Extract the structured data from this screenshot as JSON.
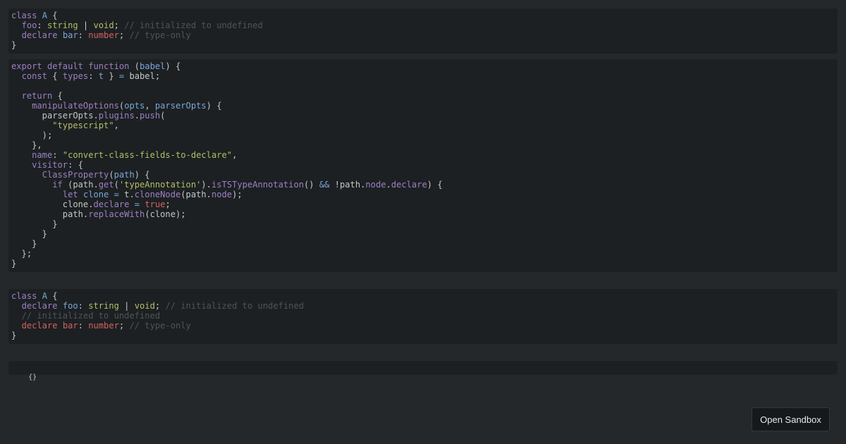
{
  "input_panel": {
    "lines": [
      [
        [
          "kw",
          "class "
        ],
        [
          "cls",
          "A"
        ],
        [
          "pn",
          " {"
        ]
      ],
      [
        [
          "pn",
          "  "
        ],
        [
          "prop",
          "foo"
        ],
        [
          "pn",
          ": "
        ],
        [
          "typ",
          "string"
        ],
        [
          "pn",
          " | "
        ],
        [
          "typ",
          "void"
        ],
        [
          "pn",
          "; "
        ],
        [
          "cm",
          "// initialized to undefined"
        ]
      ],
      [
        [
          "pn",
          "  "
        ],
        [
          "kw",
          "declare "
        ],
        [
          "cls",
          "bar"
        ],
        [
          "pn",
          ": "
        ],
        [
          "num",
          "number"
        ],
        [
          "pn",
          "; "
        ],
        [
          "cm",
          "// type-only"
        ]
      ],
      [
        [
          "pn",
          "}"
        ]
      ]
    ]
  },
  "plugin_panel": {
    "lines": [
      [
        [
          "kw",
          "export default function "
        ],
        [
          "pn",
          "("
        ],
        [
          "param",
          "babel"
        ],
        [
          "pn",
          ") {"
        ]
      ],
      [
        [
          "pn",
          "  "
        ],
        [
          "kw",
          "const "
        ],
        [
          "pn",
          "{ "
        ],
        [
          "prop",
          "types"
        ],
        [
          "pn",
          ": "
        ],
        [
          "param",
          "t"
        ],
        [
          "pn",
          " } "
        ],
        [
          "op",
          "="
        ],
        [
          "pn",
          " babel;"
        ]
      ],
      [
        [
          "pn",
          ""
        ]
      ],
      [
        [
          "pn",
          "  "
        ],
        [
          "kw",
          "return"
        ],
        [
          "pn",
          " {"
        ]
      ],
      [
        [
          "pn",
          "    "
        ],
        [
          "fn",
          "manipulateOptions"
        ],
        [
          "pn",
          "("
        ],
        [
          "param",
          "opts"
        ],
        [
          "pn",
          ", "
        ],
        [
          "param",
          "parserOpts"
        ],
        [
          "pn",
          ") {"
        ]
      ],
      [
        [
          "pn",
          "      parserOpts."
        ],
        [
          "fn",
          "plugins"
        ],
        [
          "pn",
          "."
        ],
        [
          "fn",
          "push"
        ],
        [
          "pn",
          "("
        ]
      ],
      [
        [
          "pn",
          "        "
        ],
        [
          "str",
          "\"typescript\""
        ],
        [
          "pn",
          ","
        ]
      ],
      [
        [
          "pn",
          "      );"
        ]
      ],
      [
        [
          "pn",
          "    },"
        ]
      ],
      [
        [
          "pn",
          "    "
        ],
        [
          "prop",
          "name"
        ],
        [
          "pn",
          ": "
        ],
        [
          "str",
          "\"convert-class-fields-to-declare\""
        ],
        [
          "pn",
          ","
        ]
      ],
      [
        [
          "pn",
          "    "
        ],
        [
          "prop",
          "visitor"
        ],
        [
          "pn",
          ": {"
        ]
      ],
      [
        [
          "pn",
          "      "
        ],
        [
          "fn",
          "ClassProperty"
        ],
        [
          "pn",
          "("
        ],
        [
          "param",
          "path"
        ],
        [
          "pn",
          ") {"
        ]
      ],
      [
        [
          "pn",
          "        "
        ],
        [
          "kw",
          "if"
        ],
        [
          "pn",
          " (path."
        ],
        [
          "fn",
          "get"
        ],
        [
          "pn",
          "("
        ],
        [
          "str",
          "'typeAnnotation'"
        ],
        [
          "pn",
          ")."
        ],
        [
          "fn",
          "isTSTypeAnnotation"
        ],
        [
          "pn",
          "() "
        ],
        [
          "op",
          "&&"
        ],
        [
          "pn",
          " !path."
        ],
        [
          "prop",
          "node"
        ],
        [
          "pn",
          "."
        ],
        [
          "prop",
          "declare"
        ],
        [
          "pn",
          ") {"
        ]
      ],
      [
        [
          "pn",
          "          "
        ],
        [
          "kw",
          "let "
        ],
        [
          "param",
          "clone "
        ],
        [
          "op",
          "="
        ],
        [
          "pn",
          " t."
        ],
        [
          "fn",
          "cloneNode"
        ],
        [
          "pn",
          "(path."
        ],
        [
          "prop",
          "node"
        ],
        [
          "pn",
          ");"
        ]
      ],
      [
        [
          "pn",
          "          clone."
        ],
        [
          "prop",
          "declare"
        ],
        [
          "pn",
          " "
        ],
        [
          "op",
          "="
        ],
        [
          "pn",
          " "
        ],
        [
          "bool",
          "true"
        ],
        [
          "pn",
          ";"
        ]
      ],
      [
        [
          "pn",
          "          path."
        ],
        [
          "fn",
          "replaceWith"
        ],
        [
          "pn",
          "(clone);"
        ]
      ],
      [
        [
          "pn",
          "        }"
        ]
      ],
      [
        [
          "pn",
          "      }"
        ]
      ],
      [
        [
          "pn",
          "    }"
        ]
      ],
      [
        [
          "pn",
          "  };"
        ]
      ],
      [
        [
          "pn",
          "}"
        ]
      ]
    ]
  },
  "output_panel": {
    "lines": [
      [
        [
          "kw",
          "class "
        ],
        [
          "cls",
          "A"
        ],
        [
          "pn",
          " {"
        ]
      ],
      [
        [
          "pn",
          "  "
        ],
        [
          "kw",
          "declare "
        ],
        [
          "cls",
          "foo"
        ],
        [
          "pn",
          ": "
        ],
        [
          "typ",
          "string"
        ],
        [
          "pn",
          " | "
        ],
        [
          "typ",
          "void"
        ],
        [
          "pn",
          "; "
        ],
        [
          "cm",
          "// initialized to undefined"
        ]
      ],
      [
        [
          "pn",
          "  "
        ],
        [
          "cm",
          "// initialized to undefined"
        ]
      ],
      [
        [
          "pn",
          "  "
        ],
        [
          "red",
          "declare "
        ],
        [
          "red",
          "bar"
        ],
        [
          "pn",
          ": "
        ],
        [
          "num",
          "number"
        ],
        [
          "pn",
          "; "
        ],
        [
          "cm",
          "// type-only"
        ]
      ],
      [
        [
          "pn",
          "}"
        ]
      ]
    ]
  },
  "options_panel": {
    "text": "{}"
  },
  "open_sandbox_label": "Open Sandbox"
}
